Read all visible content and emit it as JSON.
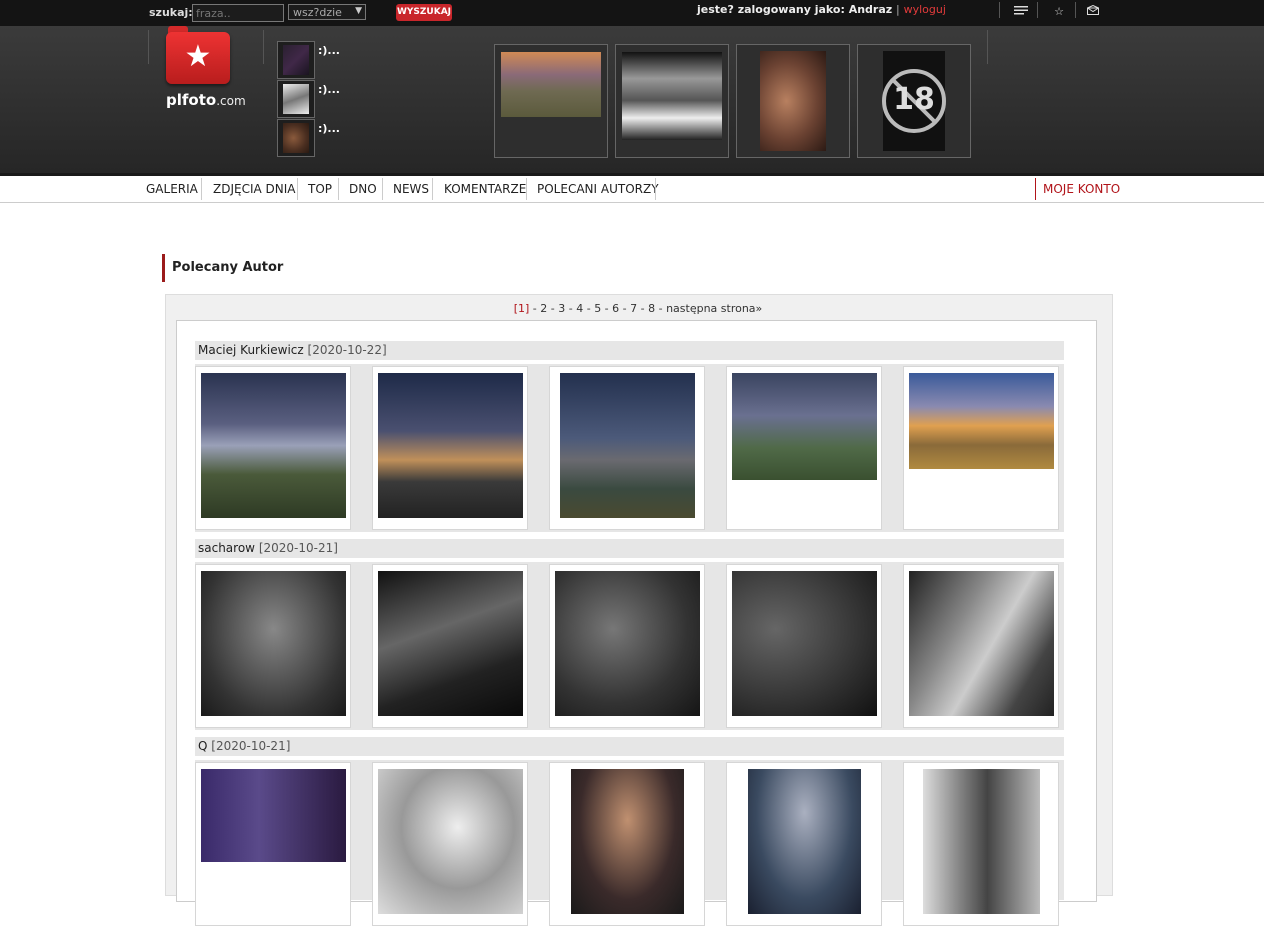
{
  "search": {
    "label": "szukaj:",
    "placeholder": "fraza..",
    "scope_selected": "wsz?dzie",
    "button_label": "WYSZUKAJ"
  },
  "user": {
    "logged_as": "jeste? zalogowany jako: Andraz",
    "separator": "|",
    "logout": "wyloguj"
  },
  "icons": [
    "list-icon",
    "star-icon",
    "envelope-icon"
  ],
  "logo": {
    "name": "plfoto",
    "suffix": ".com"
  },
  "latest": [
    {
      "caption": ":)..."
    },
    {
      "caption": ":)..."
    },
    {
      "caption": ":)..."
    }
  ],
  "featured_badge": "18",
  "nav": {
    "items": [
      "GALERIA",
      "ZDJĘCIA DNIA",
      "TOP",
      "DNO",
      "NEWS",
      "KOMENTARZE",
      "POLECANI AUTORZY"
    ],
    "account": "MOJE KONTO"
  },
  "section_title": "Polecany Autor",
  "pager": {
    "current": "[1]",
    "pages": [
      "2",
      "3",
      "4",
      "5",
      "6",
      "7",
      "8"
    ],
    "next": "następna strona»"
  },
  "authors": [
    {
      "name": "Maciej Kurkiewicz",
      "date": "[2020-10-22]"
    },
    {
      "name": "sacharow",
      "date": "[2020-10-21]"
    },
    {
      "name": "Q",
      "date": "[2020-10-21]"
    }
  ],
  "colors": {
    "accent": "#b1141a",
    "topbar": "#141414",
    "header": "#2f2f2f",
    "search_button": "#c9262b"
  }
}
